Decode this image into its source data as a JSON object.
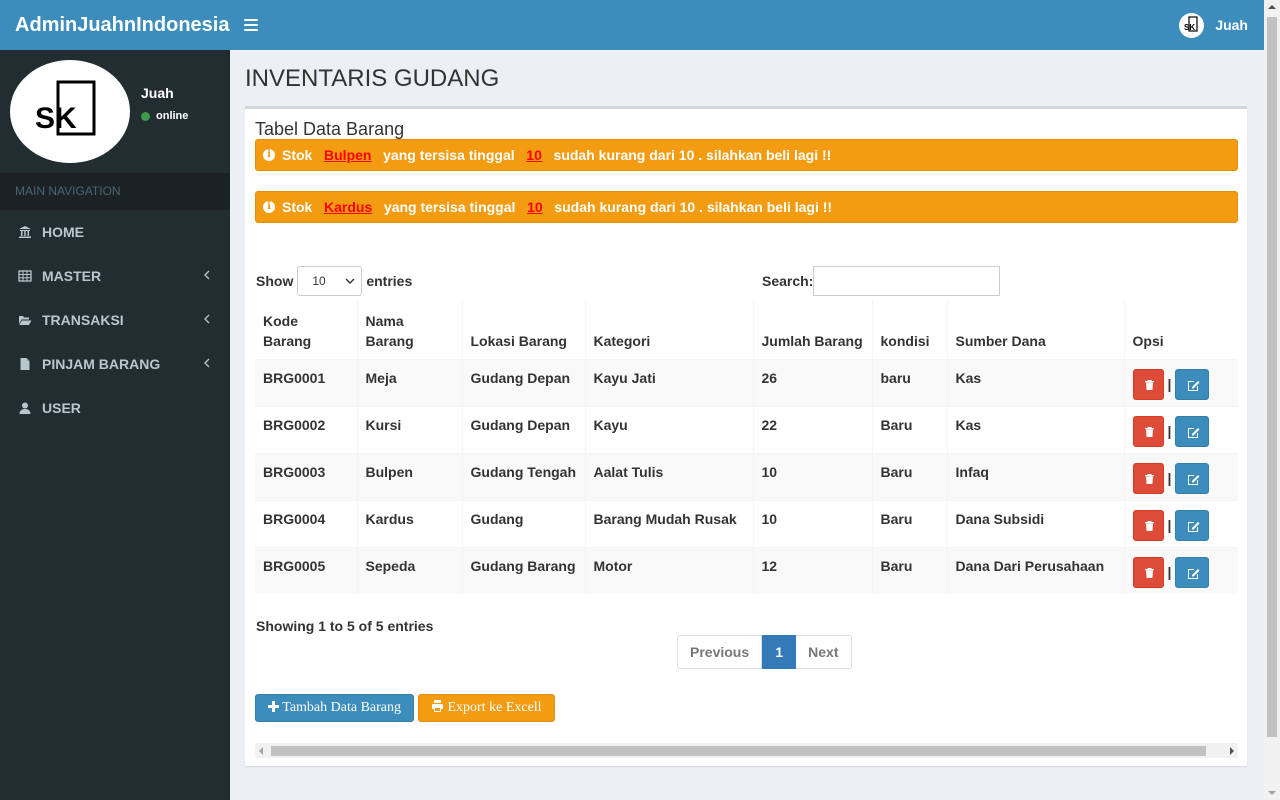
{
  "header": {
    "brand": "AdminJuahnIndonesia",
    "user_name": "Juah"
  },
  "sidebar": {
    "user_name": "Juah",
    "status": "online",
    "nav_header": "MAIN NAVIGATION",
    "items": [
      {
        "label": "HOME",
        "icon": "bank-icon",
        "has_chevron": false
      },
      {
        "label": "MASTER",
        "icon": "table-icon",
        "has_chevron": true
      },
      {
        "label": "TRANSAKSI",
        "icon": "folder-open-icon",
        "has_chevron": true
      },
      {
        "label": "PINJAM BARANG",
        "icon": "file-icon",
        "has_chevron": true
      },
      {
        "label": "USER",
        "icon": "user-icon",
        "has_chevron": false
      }
    ]
  },
  "page": {
    "title": "INVENTARIS GUDANG",
    "box_title": "Tabel Data Barang"
  },
  "alerts": [
    {
      "prefix": "Stok",
      "item": "Bulpen",
      "middle": "yang tersisa tinggal",
      "count": "10",
      "suffix": "sudah kurang dari 10 . silahkan beli lagi !!"
    },
    {
      "prefix": "Stok",
      "item": "Kardus",
      "middle": "yang tersisa tinggal",
      "count": "10",
      "suffix": "sudah kurang dari 10 . silahkan beli lagi !!"
    }
  ],
  "controls": {
    "show_label": "Show",
    "entries_value": "10",
    "entries_label": "entries",
    "search_label": "Search:",
    "search_value": ""
  },
  "table": {
    "headers": [
      [
        "Kode",
        "Barang"
      ],
      [
        "Nama",
        "Barang"
      ],
      [
        "Lokasi Barang"
      ],
      [
        "Kategori"
      ],
      [
        "Jumlah Barang"
      ],
      [
        "kondisi"
      ],
      [
        "Sumber Dana"
      ],
      [
        "Opsi"
      ]
    ],
    "rows": [
      [
        "BRG0001",
        "Meja",
        "Gudang Depan",
        "Kayu Jati",
        "26",
        "baru",
        "Kas"
      ],
      [
        "BRG0002",
        "Kursi",
        "Gudang Depan",
        "Kayu",
        "22",
        "Baru",
        "Kas"
      ],
      [
        "BRG0003",
        "Bulpen",
        "Gudang Tengah",
        "Aalat Tulis",
        "10",
        "Baru",
        "Infaq"
      ],
      [
        "BRG0004",
        "Kardus",
        "Gudang",
        "Barang Mudah Rusak",
        "10",
        "Baru",
        "Dana Subsidi"
      ],
      [
        "BRG0005",
        "Sepeda",
        "Gudang Barang",
        "Motor",
        "12",
        "Baru",
        "Dana Dari Perusahaan"
      ]
    ],
    "separator": "|"
  },
  "footer": {
    "showing": "Showing 1 to 5 of 5 entries",
    "prev": "Previous",
    "page": "1",
    "next": "Next",
    "add_button": "Tambah Data Barang",
    "export_button": "Export ke Excell"
  },
  "colors": {
    "header": "#3c8dbc",
    "sidebar": "#222d32",
    "warning": "#f39c12",
    "danger": "#dd4b39",
    "primary": "#3c8dbc"
  }
}
